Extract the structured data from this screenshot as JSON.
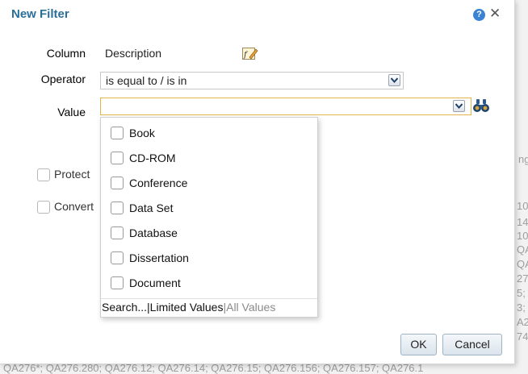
{
  "background": {
    "snippets": [
      "ng",
      "10",
      "14",
      "10",
      "QA",
      "QA",
      "27",
      "5;",
      "3;",
      "A2",
      "74"
    ],
    "bottom_line": "QA276*; QA276.280; QA276.12; QA276.14; QA276.15; QA276.156; QA276.157; QA276.1"
  },
  "dialog": {
    "title": "New Filter",
    "help_glyph": "?",
    "close_glyph": "✕"
  },
  "form": {
    "column_label": "Column",
    "column_value": "Description",
    "operator_label": "Operator",
    "operator_value": "is equal to / is in",
    "value_label": "Value",
    "value_value": ""
  },
  "options": {
    "protect_label": "Protect",
    "convert_label": "Convert"
  },
  "dropdown": {
    "items": [
      {
        "label": "Book",
        "checked": false
      },
      {
        "label": "CD-ROM",
        "checked": false
      },
      {
        "label": "Conference",
        "checked": false
      },
      {
        "label": "Data Set",
        "checked": false
      },
      {
        "label": "Database",
        "checked": false
      },
      {
        "label": "Dissertation",
        "checked": false
      },
      {
        "label": "Document",
        "checked": false
      }
    ],
    "footer": {
      "search": "Search...",
      "limited": "Limited Values",
      "all": "All Values",
      "sep": "|"
    }
  },
  "buttons": {
    "ok": "OK",
    "cancel": "Cancel"
  },
  "colors": {
    "title": "#2a6f97",
    "focus_border": "#e3b44c",
    "help": "#3a82d2"
  }
}
